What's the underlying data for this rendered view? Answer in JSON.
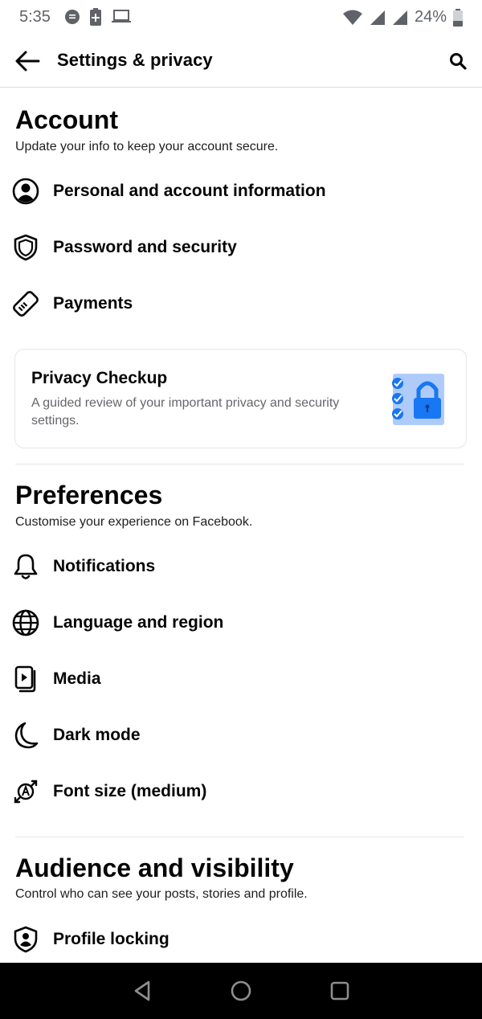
{
  "status": {
    "time": "5:35",
    "battery": "24%"
  },
  "header": {
    "title": "Settings & privacy"
  },
  "account": {
    "title": "Account",
    "subtitle": "Update your info to keep your account secure.",
    "items": [
      {
        "label": "Personal and account information",
        "icon": "person-circle-icon"
      },
      {
        "label": "Password and security",
        "icon": "shield-icon"
      },
      {
        "label": "Payments",
        "icon": "tag-icon"
      }
    ]
  },
  "privacy_checkup": {
    "title": "Privacy Checkup",
    "description": "A guided review of your important privacy and security settings."
  },
  "preferences": {
    "title": "Preferences",
    "subtitle": "Customise your experience on Facebook.",
    "items": [
      {
        "label": "Notifications",
        "icon": "bell-icon"
      },
      {
        "label": "Language and region",
        "icon": "globe-icon"
      },
      {
        "label": "Media",
        "icon": "media-icon"
      },
      {
        "label": "Dark mode",
        "icon": "moon-icon"
      },
      {
        "label": "Font size (medium)",
        "icon": "font-size-icon"
      }
    ]
  },
  "audience": {
    "title": "Audience and visibility",
    "subtitle": "Control who can see your posts, stories and profile.",
    "items": [
      {
        "label": "Profile locking",
        "icon": "profile-lock-icon"
      }
    ]
  },
  "colors": {
    "accent": "#1877f2",
    "text": "#050505",
    "secondary_text": "#65676b"
  }
}
